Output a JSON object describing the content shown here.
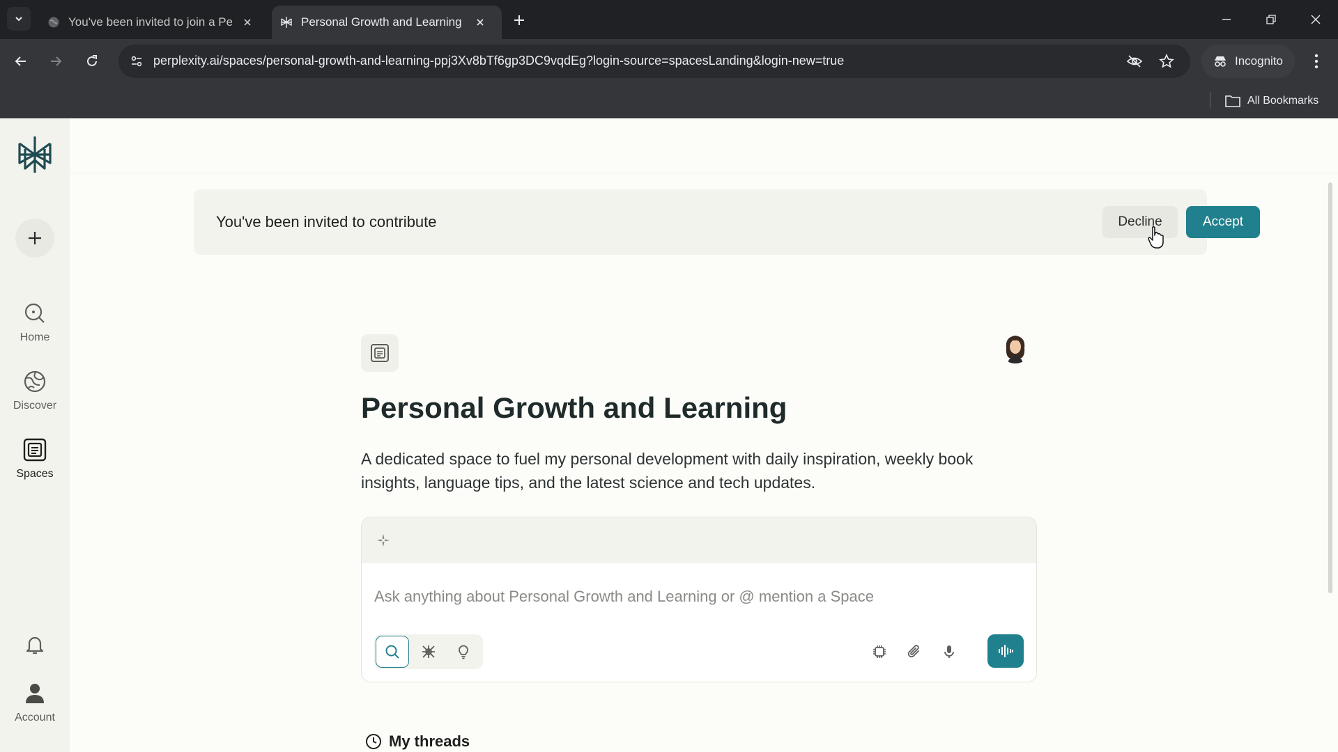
{
  "browser": {
    "tabs": [
      {
        "title": "You've been invited to join a Pe",
        "favicon": "globe-icon",
        "active": false
      },
      {
        "title": "Personal Growth and Learning",
        "favicon": "perplexity-icon",
        "active": true
      }
    ],
    "url": "perplexity.ai/spaces/personal-growth-and-learning-ppj3Xv8bTf6gp3DC9vqdEg?login-source=spacesLanding&login-new=true",
    "incognito_label": "Incognito",
    "all_bookmarks_label": "All Bookmarks"
  },
  "sidebar": {
    "items": [
      {
        "label": "Home",
        "icon": "home-icon"
      },
      {
        "label": "Discover",
        "icon": "discover-icon"
      },
      {
        "label": "Spaces",
        "icon": "spaces-icon"
      },
      {
        "label": "Account",
        "icon": "account-icon"
      }
    ]
  },
  "invite": {
    "text": "You've been invited to contribute",
    "decline_label": "Decline",
    "accept_label": "Accept"
  },
  "space": {
    "title": "Personal Growth and Learning",
    "description": "A dedicated space to fuel my personal development with daily inspiration, weekly book insights, language tips, and the latest science and tech updates."
  },
  "prompt": {
    "placeholder": "Ask anything about Personal Growth and Learning or @ mention a Space",
    "value": ""
  },
  "threads": {
    "label": "My threads"
  },
  "colors": {
    "accent": "#20808d",
    "sidebar_bg": "#f3f3ee",
    "page_bg": "#fcfcf9"
  }
}
